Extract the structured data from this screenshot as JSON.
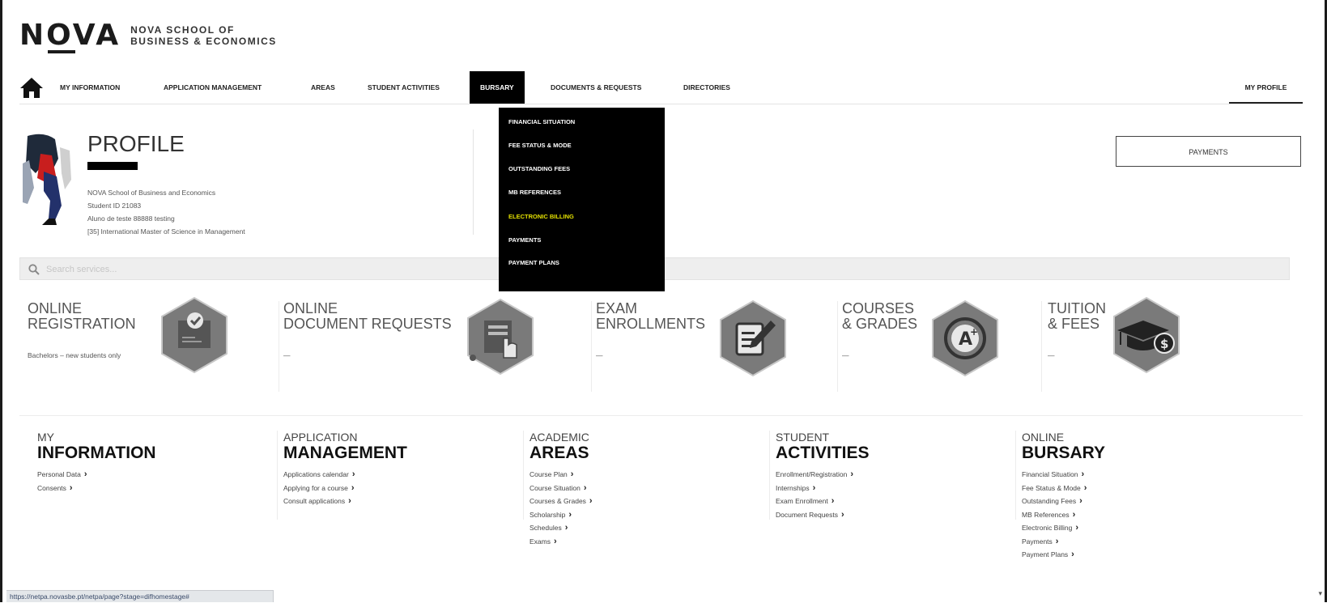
{
  "brand": {
    "word_left": "N",
    "word_mid": "O",
    "word_right": "VA",
    "subtitle_line1": "NOVA SCHOOL OF",
    "subtitle_line2": "BUSINESS & ECONOMICS"
  },
  "nav": {
    "items": [
      {
        "label": "MY INFORMATION"
      },
      {
        "label": "APPLICATION MANAGEMENT"
      },
      {
        "label": "AREAS"
      },
      {
        "label": "STUDENT ACTIVITIES"
      },
      {
        "label": "BURSARY"
      },
      {
        "label": "DOCUMENTS & REQUESTS"
      },
      {
        "label": "DIRECTORIES"
      }
    ],
    "profile_label": "MY PROFILE"
  },
  "dropdown": {
    "items": [
      {
        "label": "FINANCIAL SITUATION"
      },
      {
        "label": "FEE STATUS & MODE"
      },
      {
        "label": "OUTSTANDING FEES"
      },
      {
        "label": "MB REFERENCES"
      },
      {
        "label": "ELECTRONIC BILLING",
        "highlighted": true
      },
      {
        "label": "PAYMENTS"
      },
      {
        "label": "PAYMENT PLANS"
      }
    ]
  },
  "profile": {
    "title": "PROFILE",
    "lines": [
      "NOVA School of Business and Economics",
      "Student ID 21083",
      "Aluno de teste 88888 testing",
      "[35] International Master of Science in Management"
    ]
  },
  "payments_button": "PAYMENTS",
  "search": {
    "placeholder": "Search services..."
  },
  "services": [
    {
      "title": "ONLINE\nREGISTRATION",
      "desc": "Bachelors – new students only",
      "icon": "registration-icon"
    },
    {
      "title": "ONLINE\nDOCUMENT REQUESTS",
      "desc": "—",
      "icon": "document-request-icon"
    },
    {
      "title": "EXAM\nENROLLMENTS",
      "desc": "—",
      "icon": "exam-enrollment-icon"
    },
    {
      "title": "COURSES\n& GRADES",
      "desc": "—",
      "icon": "grades-icon"
    },
    {
      "title": "TUITION\n& FEES",
      "desc": "—",
      "icon": "tuition-icon"
    }
  ],
  "columns": [
    {
      "sub": "MY",
      "title": "INFORMATION",
      "links": [
        "Personal Data",
        "Consents"
      ]
    },
    {
      "sub": "APPLICATION",
      "title": "MANAGEMENT",
      "links": [
        "Applications calendar",
        "Applying for a course",
        "Consult applications"
      ]
    },
    {
      "sub": "ACADEMIC",
      "title": "AREAS",
      "links": [
        "Course Plan",
        "Course Situation",
        "Courses & Grades",
        "Scholarship",
        "Schedules",
        "Exams"
      ]
    },
    {
      "sub": "STUDENT",
      "title": "ACTIVITIES",
      "links": [
        "Enrollment/Registration",
        "Internships",
        "Exam Enrollment",
        "Document Requests"
      ]
    },
    {
      "sub": "ONLINE",
      "title": "BURSARY",
      "links": [
        "Financial Situation",
        "Fee Status & Mode",
        "Outstanding Fees",
        "MB References",
        "Electronic Billing",
        "Payments",
        "Payment Plans"
      ]
    }
  ],
  "status_url": "https://netpa.novasbe.pt/netpa/page?stage=difhomestage#",
  "colors": {
    "accent_black": "#000000",
    "highlight": "#e3e000",
    "hex_icon": "#7a7a7a"
  }
}
